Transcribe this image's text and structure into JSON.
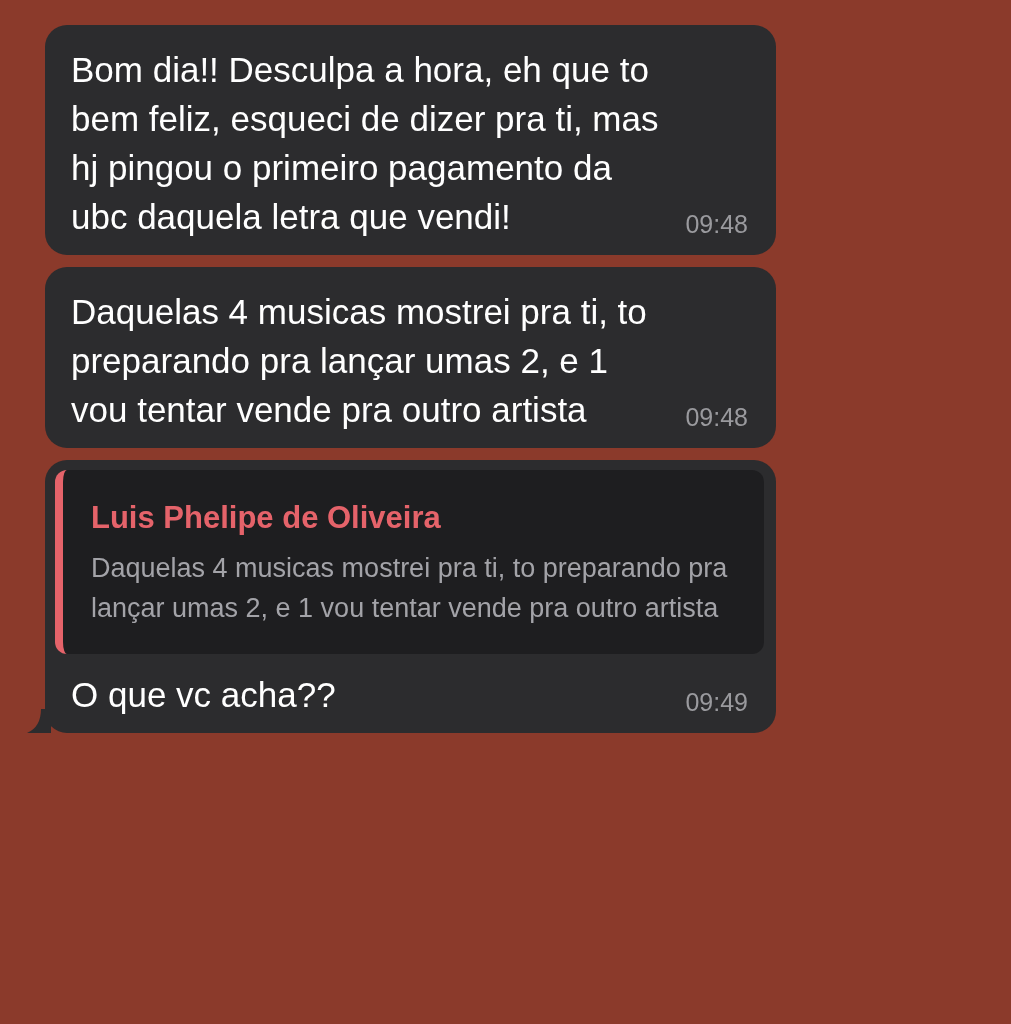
{
  "messages": [
    {
      "kind": "text",
      "text": "Bom dia!! Desculpa a hora, eh que to bem feliz, esqueci de dizer pra ti, mas hj pingou o primeiro pagamento da ubc daquela letra que vendi!",
      "time": "09:48",
      "tail": false
    },
    {
      "kind": "text",
      "text": "Daquelas 4 musicas mostrei pra ti, to preparando pra lançar umas 2, e 1 vou tentar vende pra outro artista",
      "time": "09:48",
      "tail": false
    },
    {
      "kind": "reply",
      "quote": {
        "author": "Luis Phelipe de Oliveira",
        "text": "Daquelas 4 musicas mostrei pra ti, to preparando pra lançar umas 2, e 1 vou tentar vende pra outro artista",
        "color": "#e5636a"
      },
      "text": "O que vc acha??",
      "time": "09:49",
      "tail": true
    }
  ]
}
